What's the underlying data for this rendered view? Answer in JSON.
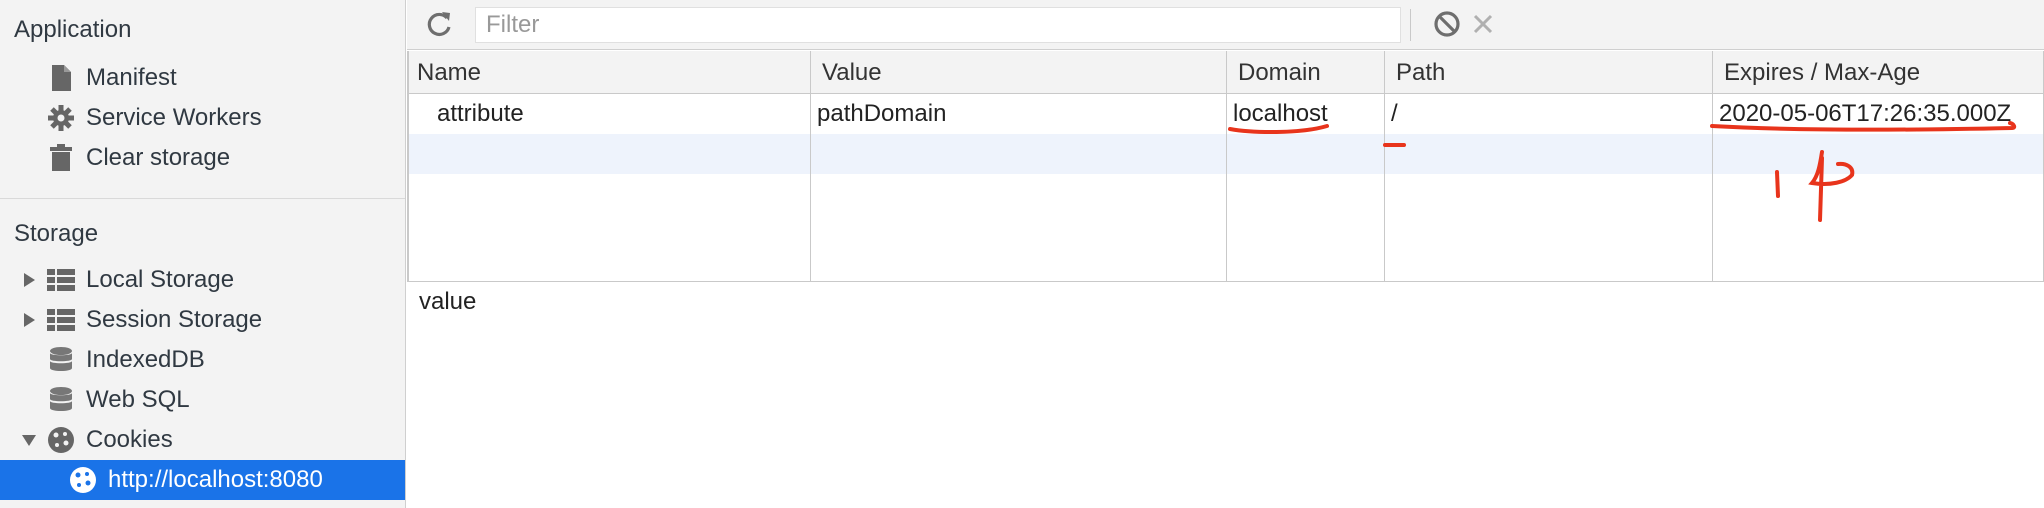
{
  "sidebar": {
    "application_title": "Application",
    "app_items": [
      {
        "label": "Manifest",
        "icon": "file-icon"
      },
      {
        "label": "Service Workers",
        "icon": "gear-icon"
      },
      {
        "label": "Clear storage",
        "icon": "trash-icon"
      }
    ],
    "storage_title": "Storage",
    "storage_items": [
      {
        "label": "Local Storage",
        "icon": "grid-table-icon"
      },
      {
        "label": "Session Storage",
        "icon": "grid-table-icon"
      },
      {
        "label": "IndexedDB",
        "icon": "database-icon"
      },
      {
        "label": "Web SQL",
        "icon": "database-icon"
      },
      {
        "label": "Cookies",
        "icon": "cookie-icon"
      }
    ],
    "selected_item": {
      "label": "http://localhost:8080",
      "icon": "cookie-icon"
    }
  },
  "toolbar": {
    "refresh_icon": "refresh-icon",
    "filter_placeholder": "Filter",
    "clear_all_icon": "block-icon",
    "delete_icon": "close-icon"
  },
  "table": {
    "columns": [
      "Name",
      "Value",
      "Domain",
      "Path",
      "Expires / Max-Age"
    ],
    "rows": [
      [
        "attribute",
        "pathDomain",
        "localhost",
        "/",
        "2020-05-06T17:26:35.000Z"
      ]
    ]
  },
  "preview": {
    "text": "value"
  },
  "annotation": {
    "color": "#e8341c",
    "handwritten": "14"
  },
  "colors": {
    "selected": "#1a73e8",
    "row_highlight": "#eef3fc"
  }
}
